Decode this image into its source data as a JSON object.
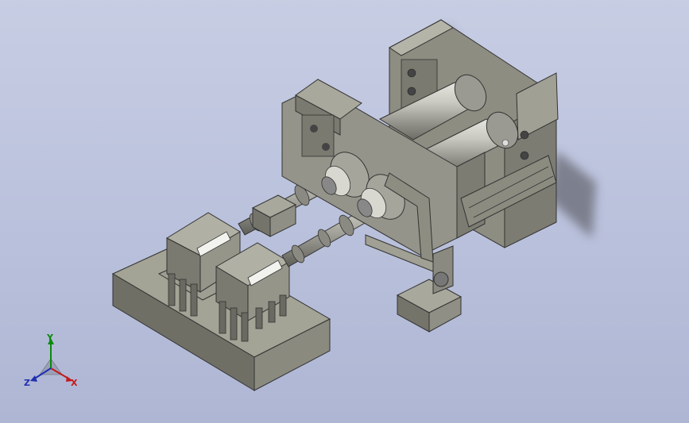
{
  "viewport": {
    "background_top": "#c7cde3",
    "background_bottom": "#aeb6d4",
    "model_color": "#8d8d82",
    "roll_color": "#b8b8b0"
  },
  "triad": {
    "y_label": "Y",
    "x_label": "X",
    "z_label": "Z",
    "y_color": "#0a8a0a",
    "x_color": "#c41a1a",
    "z_color": "#2030b0"
  }
}
